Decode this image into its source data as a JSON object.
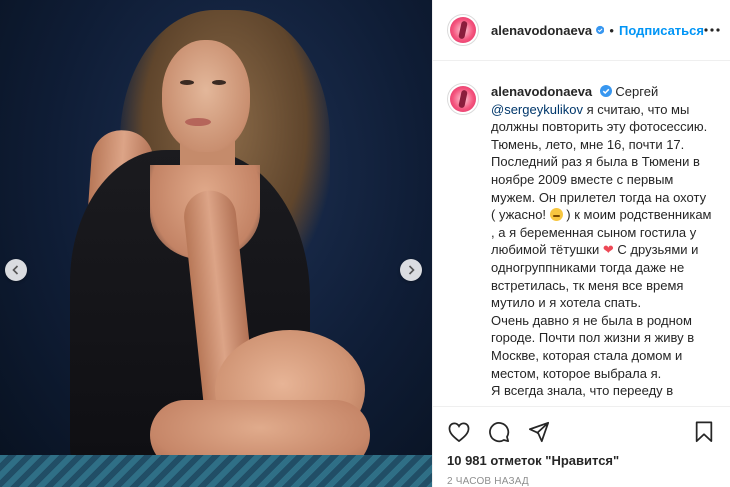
{
  "post": {
    "username": "alenavodonaeva",
    "follow_label": "Подписаться",
    "dot": "•",
    "caption": {
      "username": "alenavodonaeva",
      "lines": [
        {
          "parts": [
            {
              "t": "Сергей "
            },
            {
              "t": "@sergeykulikov",
              "mention": true
            },
            {
              "t": " я считаю, что мы должны повторить эту фотосессию. Тюмень, лето, мне 16, почти 17. Последний раз я была в Тюмени в ноябре 2009 вместе с первым мужем. Он прилетел тогда на охоту ( ужасно! "
            }
          ]
        },
        {
          "parts": []
        }
      ],
      "text_1": "Сергей",
      "mention": "@sergeykulikov",
      "text_2": "я считаю, что мы должны повторить эту фотосессию. Тюмень, лето, мне 16, почти 17. Последний раз я была в Тюмени в ноябре 2009 вместе с первым мужем. Он прилетел тогда на охоту ( ужасно!",
      "text_3": ") к моим родственникам , а я беременная сыном гостила у любимой тётушки",
      "text_4": "С друзьями и одногруппниками тогда даже не встретилась, тк меня все время мутило и я хотела спать.",
      "text_5": "Очень давно я не была в родном городе. Почти пол жизни я живу в Москве, которая стала домом и местом, которое выбрала я.",
      "text_6": "Я всегда знала, что перееду в столицу из нашего холодного",
      "heart": "❤"
    },
    "likes": "10 981 отметок \"Нравится\"",
    "time": "2 ЧАСОВ НАЗАД"
  },
  "icons": {
    "verified": "verified-badge-icon",
    "more": "more-options-icon",
    "like": "heart-icon",
    "comment": "comment-icon",
    "share": "share-icon",
    "save": "bookmark-icon",
    "prev": "chevron-left-icon",
    "next": "chevron-right-icon"
  },
  "colors": {
    "accent": "#0095f6",
    "text": "#262626",
    "muted": "#8e8e8e",
    "mention": "#00376b",
    "heart": "#ed4956"
  }
}
